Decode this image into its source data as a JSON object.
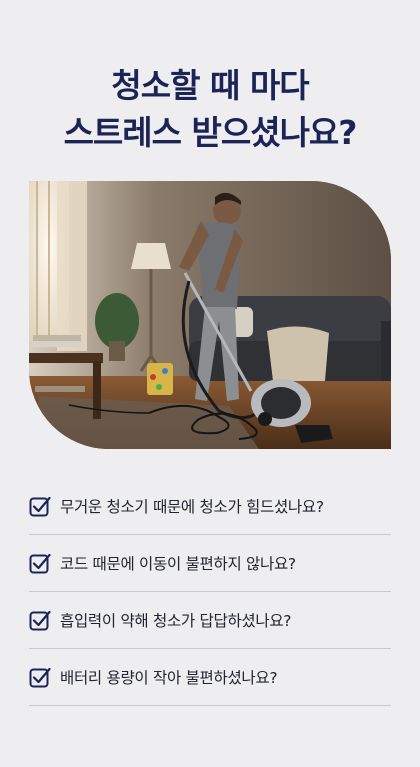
{
  "headline": {
    "line1": "청소할 때 마다",
    "line2": "스트레스 받으셨나요?"
  },
  "colors": {
    "headline": "#1c2456",
    "check_icon": "#1c2456",
    "background": "#eeeef0",
    "divider": "#c8c9cf"
  },
  "checklist": [
    {
      "icon": "checkbox-checked-icon",
      "text": "무거운 청소기 때문에 청소가 힘드셨나요?"
    },
    {
      "icon": "checkbox-checked-icon",
      "text": "코드 때문에 이동이 불편하지 않나요?"
    },
    {
      "icon": "checkbox-checked-icon",
      "text": "흡입력이 약해 청소가 답답하셨나요?"
    },
    {
      "icon": "checkbox-checked-icon",
      "text": "배터리 용량이 작아 불편하셨나요?"
    }
  ]
}
